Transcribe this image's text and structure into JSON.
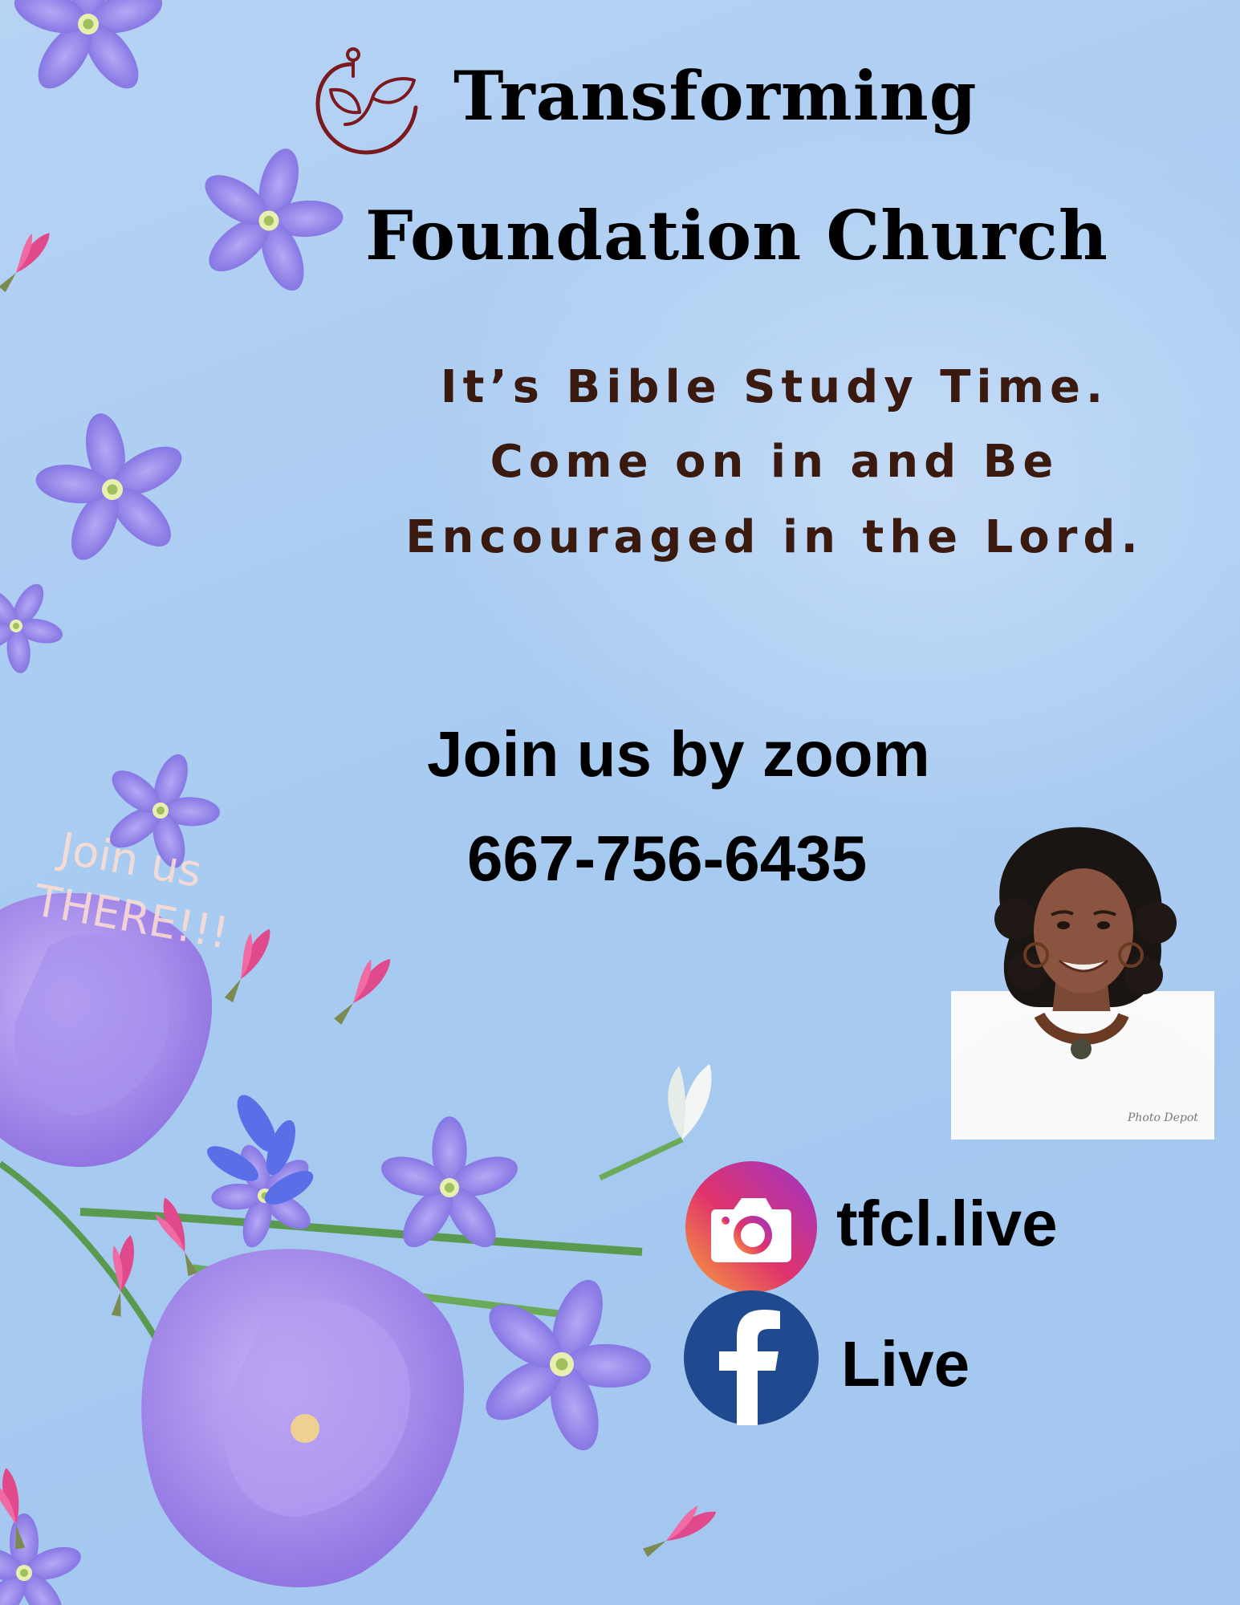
{
  "church": {
    "title_line1": "Transforming",
    "title_line2": "Foundation Church",
    "logo_icon": "church-sprout-logo-icon",
    "logo_color": "#7a1a1e"
  },
  "message": {
    "line1": "It’s Bible Study Time.",
    "line2": "Come on in and Be",
    "line3": "Encouraged in the Lord.",
    "color": "#3a1a0e"
  },
  "zoom": {
    "line1": "Join us by zoom",
    "phone": "667-756-6435"
  },
  "overlay": {
    "line1": "Join us",
    "line2": "THERE!!!"
  },
  "social": {
    "instagram": {
      "icon": "instagram-camera-icon",
      "label": "tfcl.live"
    },
    "facebook": {
      "icon": "facebook-f-icon",
      "label": "Live",
      "color": "#1f4a8f"
    }
  },
  "photo": {
    "stamp": "Photo Depot"
  },
  "colors": {
    "background": "#a9cbf1",
    "flower_purple": "#8a7ee6",
    "flower_pink": "#e04a8c"
  }
}
